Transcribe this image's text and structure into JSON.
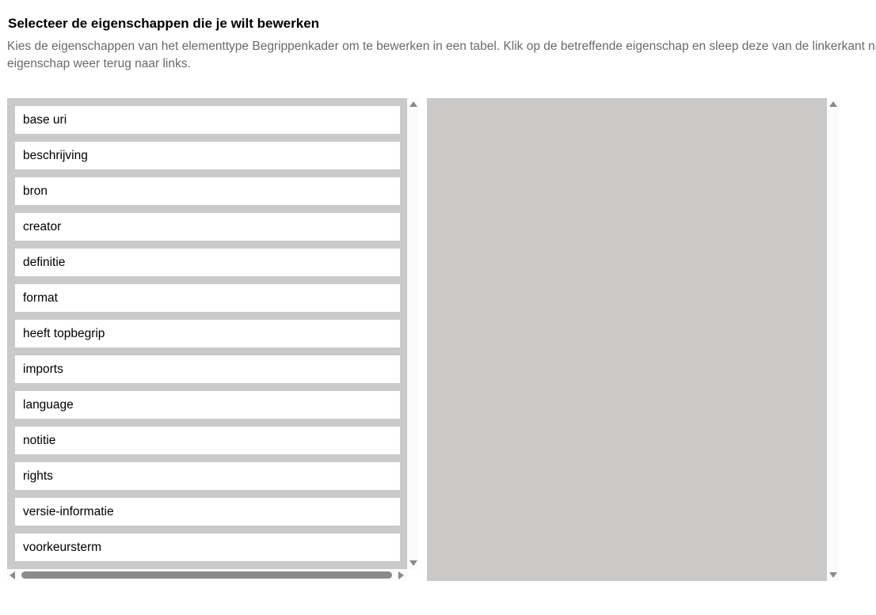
{
  "heading": "Selecteer de eigenschappen die je wilt bewerken",
  "description": {
    "line1": "Kies de eigenschappen van het elementtype Begrippenkader om te bewerken in een tabel. Klik op de betreffende eigenschap en sleep deze van de linkerkant naar de rechterkant. Sleep een",
    "line2": "eigenschap weer terug naar links."
  },
  "available_properties": [
    "base uri",
    "beschrijving",
    "bron",
    "creator",
    "definitie",
    "format",
    "heeft topbegrip",
    "imports",
    "language",
    "notitie",
    "rights",
    "versie-informatie",
    "voorkeursterm"
  ],
  "selected_properties": [],
  "colors": {
    "list_background": "#cacaca",
    "drop_zone_background": "#cac9c7",
    "item_background": "#ffffff",
    "scrollbar_thumb": "#8a8a8a",
    "description_text": "#6a6a6a"
  },
  "icons": {
    "scroll_up": "triangle-up",
    "scroll_down": "triangle-down",
    "scroll_left": "triangle-left",
    "scroll_right": "triangle-right"
  }
}
